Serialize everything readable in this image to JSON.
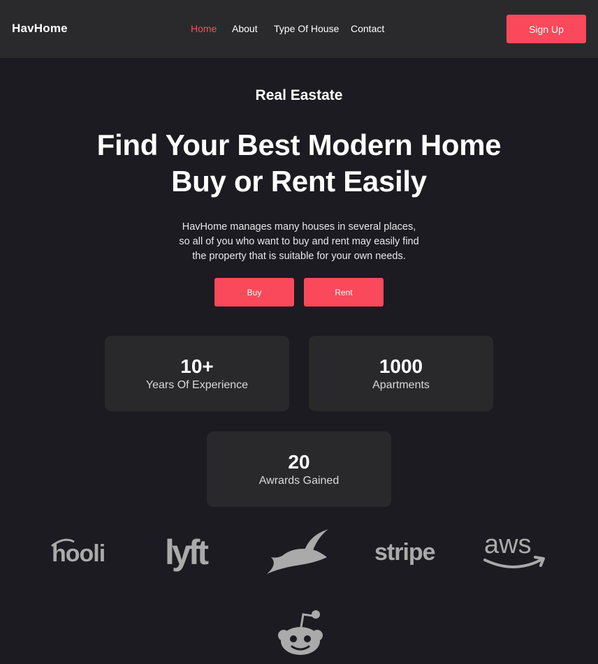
{
  "nav": {
    "brand": "HavHome",
    "links": [
      "Home",
      "About",
      "Type Of House",
      "Contact"
    ],
    "signup": "Sign Up"
  },
  "hero": {
    "eyebrow": "Real Eastate",
    "headline_1": "Find Your Best Modern Home",
    "headline_2": "Buy or Rent Easily",
    "lead_1": "HavHome manages many houses in several places,",
    "lead_2": "so all of you who want to buy and rent may easily find",
    "lead_3": "the property that is suitable for your own needs.",
    "buy": "Buy",
    "rent": "Rent"
  },
  "stats": [
    {
      "value": "10+",
      "label": "Years Of Experience"
    },
    {
      "value": "1000",
      "label": "Apartments"
    },
    {
      "value": "20",
      "label": "Awrards Gained"
    }
  ],
  "logos": {
    "hooli": "hooli",
    "lyft": "lyft",
    "stripe": "stripe",
    "aws": "aws"
  },
  "colors": {
    "accent": "#f9495a",
    "background": "#1b1b21",
    "card": "#29292b",
    "logo_gray": "#aaaaaa"
  }
}
